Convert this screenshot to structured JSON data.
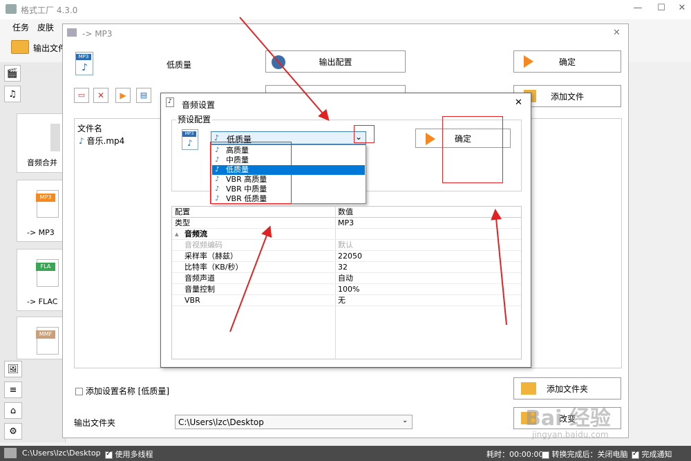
{
  "main_window": {
    "title": "格式工厂 4.3.0",
    "controls": {
      "minimize": "—",
      "maximize": "☐",
      "close": "✕"
    },
    "menu": [
      "任务",
      "皮肤"
    ],
    "toolbar": {
      "output_folder_label": "输出文件"
    },
    "tool_cards": [
      {
        "label": "音频合并"
      },
      {
        "label": "-> MP3",
        "badge": "MP3",
        "badge_color": "#f5891f"
      },
      {
        "label": "-> FLAC",
        "badge": "FLA",
        "badge_color": "#3aa655"
      },
      {
        "label": "",
        "badge": "MMF",
        "badge_color": "#c9a07a"
      }
    ]
  },
  "status_bar": {
    "output_path": "C:\\Users\\lzc\\Desktop",
    "multithread_label": "使用多线程",
    "elapsed_label": "耗时：00:00:00",
    "after_convert_label": "转换完成后：关闭电脑",
    "notify_label": "完成通知"
  },
  "mp3_dialog": {
    "title": "-> MP3",
    "quality_label": "低质量",
    "output_config_button": "输出配置",
    "ok_button": "确定",
    "add_file_button": "添加文件",
    "file_list_header": "文件名",
    "files": [
      "音乐.mp4"
    ],
    "add_setting_name_label": "添加设置名称 [低质量]",
    "add_folder_button": "添加文件夹",
    "output_folder_label": "输出文件夹",
    "output_folder_value": "C:\\Users\\lzc\\Desktop",
    "change_button": "改变"
  },
  "audio_dialog": {
    "title": "音频设置",
    "close": "✕",
    "preset_group_label": "预设配置",
    "preset_selected": "低质量",
    "preset_options": [
      "高质量",
      "中质量",
      "低质量",
      "VBR 高质量",
      "VBR 中质量",
      "VBR 低质量"
    ],
    "ok_button": "确定",
    "table_headers": [
      "配置",
      "数值"
    ],
    "rows": [
      {
        "name": "类型",
        "value": "MP3",
        "indent": false,
        "disabled": false
      },
      {
        "name": "音频流",
        "value": "",
        "indent": false,
        "section": true
      },
      {
        "name": "音视频编码",
        "value": "默认",
        "indent": true,
        "disabled": true
      },
      {
        "name": "采样率（赫兹）",
        "value": "22050",
        "indent": true,
        "disabled": false
      },
      {
        "name": "比特率（KB/秒）",
        "value": "32",
        "indent": true,
        "disabled": false
      },
      {
        "name": "音频声道",
        "value": "自动",
        "indent": true,
        "disabled": false
      },
      {
        "name": "音量控制",
        "value": "100%",
        "indent": true,
        "disabled": false
      },
      {
        "name": "VBR",
        "value": "无",
        "indent": true,
        "disabled": false
      }
    ]
  },
  "watermark": {
    "text": "Bai 经验",
    "url": "jingyan.baidu.com"
  },
  "colors": {
    "annotation_red": "#e22222",
    "selection_blue": "#0078d7",
    "accent_orange": "#f5891f"
  }
}
